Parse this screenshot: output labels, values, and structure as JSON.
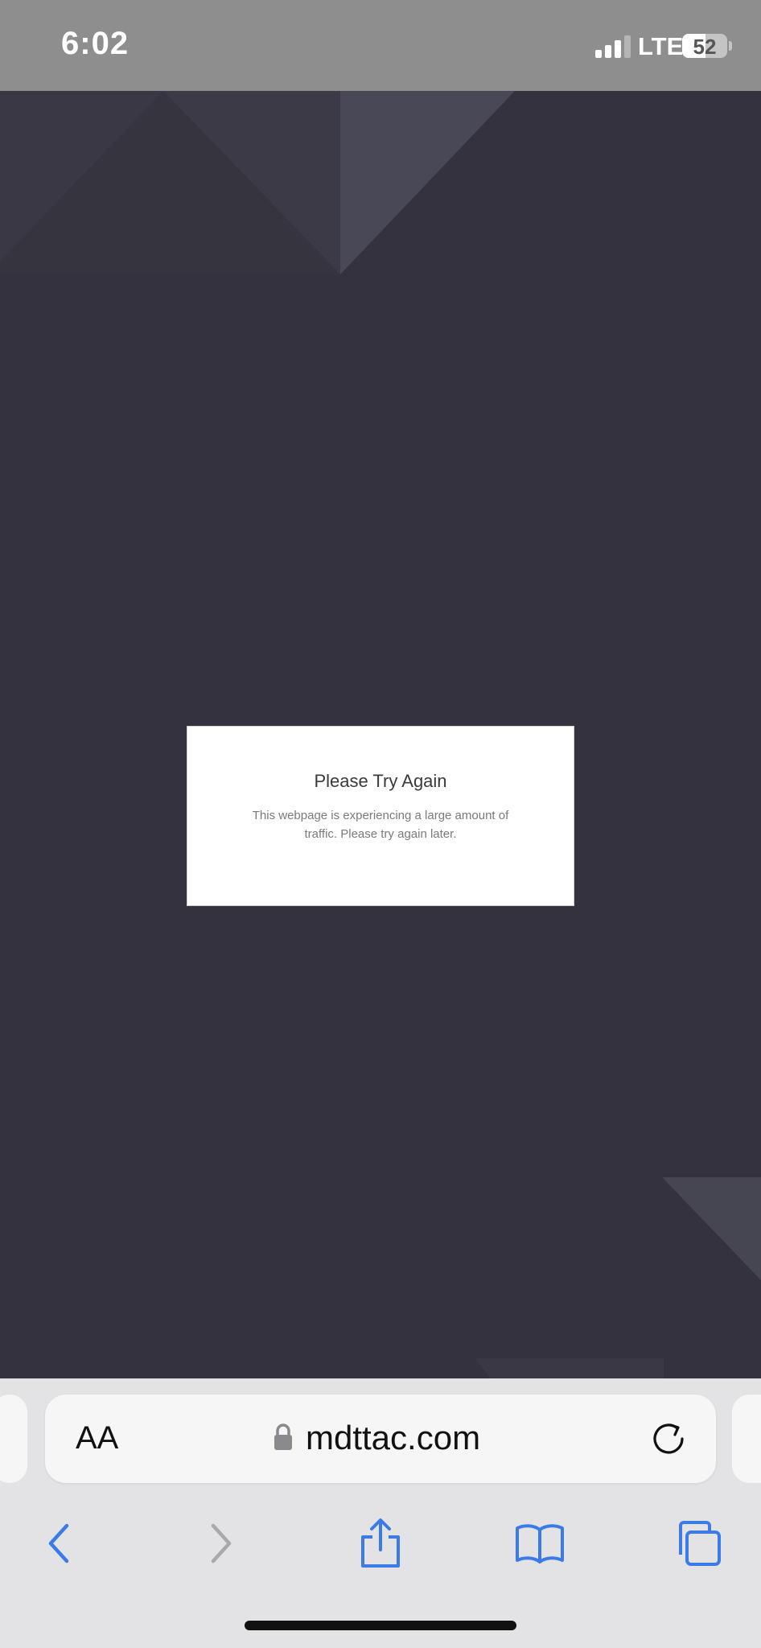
{
  "status_bar": {
    "time": "6:02",
    "network": "LTE",
    "battery_percent": 52,
    "battery_label": "52",
    "signal_bars_active": 3,
    "signal_bars_total": 4
  },
  "dialog": {
    "title": "Please Try Again",
    "message": "This webpage is experiencing a large amount of traffic. Please try again later."
  },
  "address_bar": {
    "text_size_label": "AA",
    "url": "mdttac.com"
  },
  "toolbar": {
    "icons": [
      "back-icon",
      "forward-icon",
      "share-icon",
      "bookmarks-icon",
      "tabs-icon"
    ]
  },
  "colors": {
    "page_background": "#33323e",
    "accent_blue": "#3b7be8",
    "status_bar": "#8e8e8e"
  }
}
